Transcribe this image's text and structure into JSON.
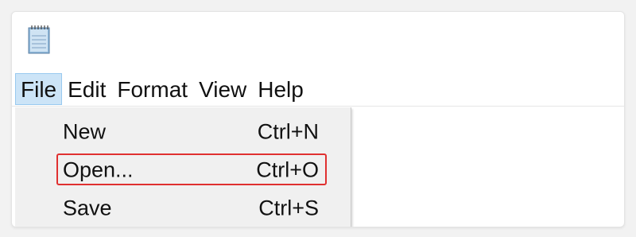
{
  "app": {
    "icon": "notepad-icon"
  },
  "menubar": {
    "items": [
      {
        "label": "File",
        "active": true
      },
      {
        "label": "Edit"
      },
      {
        "label": "Format"
      },
      {
        "label": "View"
      },
      {
        "label": "Help"
      }
    ]
  },
  "file_menu": {
    "items": [
      {
        "label": "New",
        "shortcut": "Ctrl+N"
      },
      {
        "label": "Open...",
        "shortcut": "Ctrl+O",
        "highlighted": true
      },
      {
        "label": "Save",
        "shortcut": "Ctrl+S"
      }
    ]
  },
  "colors": {
    "active_menu_bg": "#cce4f7",
    "highlight_border": "#e03030",
    "dropdown_bg": "#f0f0f0"
  }
}
